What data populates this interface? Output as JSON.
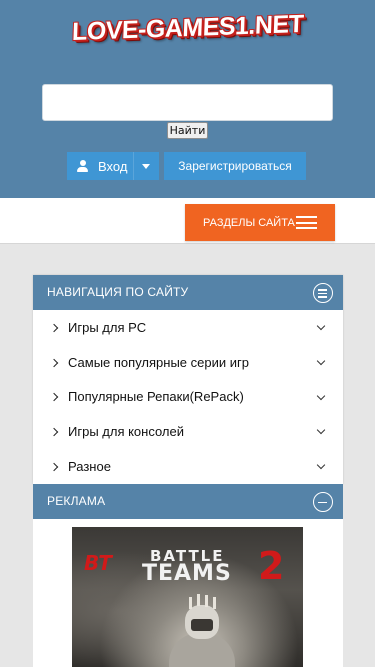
{
  "header": {
    "logo_text": "LOVE-GAMES1.NET",
    "search": {
      "value": "",
      "placeholder": "",
      "button_label": "Найти"
    },
    "login_label": "Вход",
    "register_label": "Зарегистрироваться"
  },
  "menu": {
    "sections_label": "РАЗДЕЛЫ САЙТА"
  },
  "navigation": {
    "title": "НАВИГАЦИЯ ПО САЙТУ",
    "items": [
      {
        "label": "Игры для PC"
      },
      {
        "label": "Самые популярные серии игр"
      },
      {
        "label": "Популярные Репаки(RePack)"
      },
      {
        "label": "Игры для консолей"
      },
      {
        "label": "Разное"
      }
    ]
  },
  "ad": {
    "title": "РЕКЛАМА",
    "banner": {
      "brand_mark": "BT",
      "word1": "BATTLE",
      "word2": "TEAMS",
      "number": "2"
    }
  },
  "colors": {
    "header_bg": "#5583a8",
    "button_blue": "#3f96d4",
    "accent_orange": "#f06421",
    "page_bg": "#e6e6e6"
  },
  "icons": [
    "user-icon",
    "caret-down-icon",
    "hamburger-icon",
    "menu-circle-icon",
    "minus-circle-icon",
    "chevron-right-icon",
    "chevron-down-icon"
  ]
}
